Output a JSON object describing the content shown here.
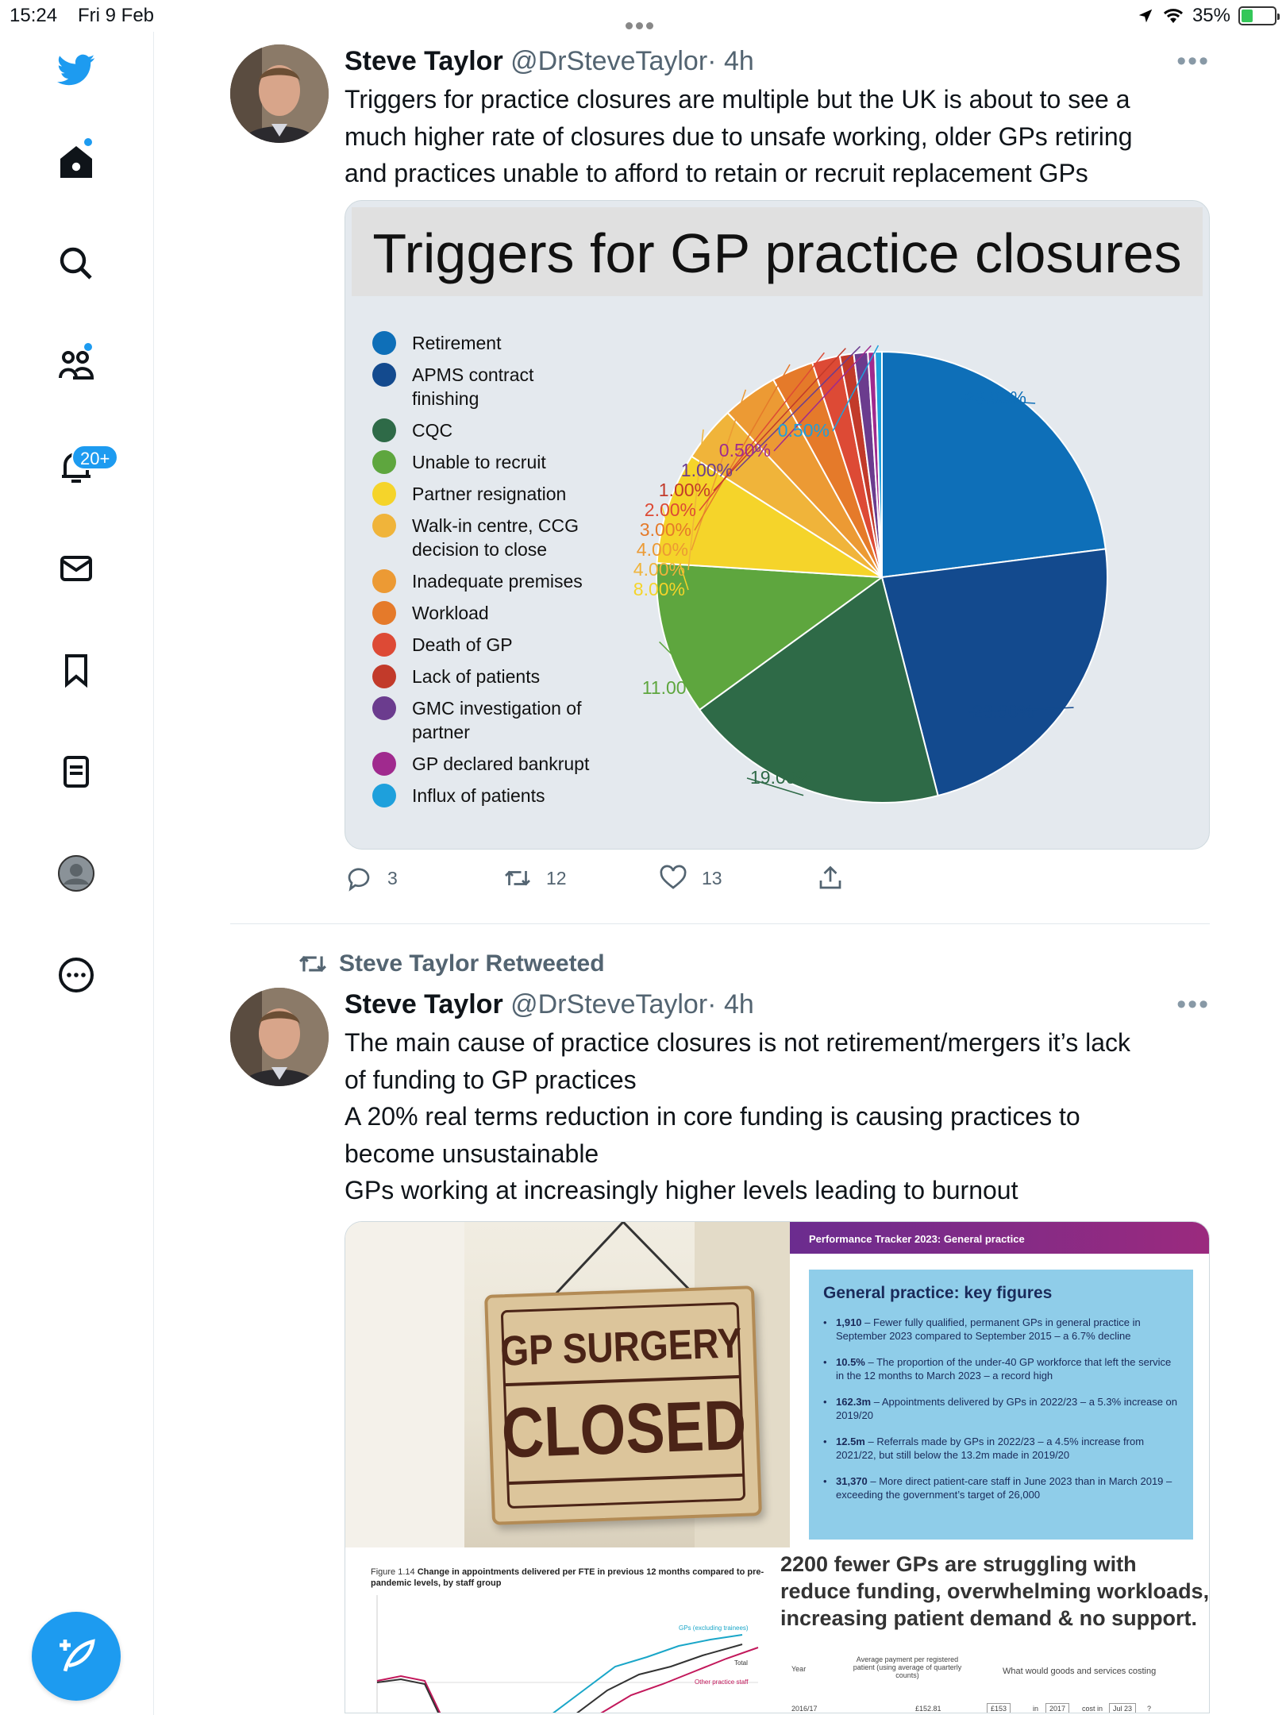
{
  "status_bar": {
    "time": "15:24",
    "date": "Fri 9 Feb",
    "battery": "35%",
    "battery_level": 0.35
  },
  "sidebar": {
    "items": [
      {
        "name": "twitter-logo"
      },
      {
        "name": "home"
      },
      {
        "name": "explore"
      },
      {
        "name": "communities"
      },
      {
        "name": "notifications"
      },
      {
        "name": "messages"
      },
      {
        "name": "bookmarks"
      },
      {
        "name": "lists"
      },
      {
        "name": "profile"
      },
      {
        "name": "more"
      }
    ],
    "notifications_badge": "20+"
  },
  "tweet1": {
    "name": "Steve Taylor",
    "handle": "@DrSteveTaylor",
    "time": "· 4h",
    "text_lines": [
      "Triggers for practice closures are multiple but the UK is about to see a",
      "much higher rate of closures due to unsafe working, older GPs retiring",
      "and practices unable to afford to retain or recruit replacement GPs"
    ],
    "actions": {
      "replies": "3",
      "retweets": "12",
      "likes": "13"
    }
  },
  "chart_data": {
    "type": "pie",
    "title": "Triggers for GP practice closures",
    "labels": [
      "Retirement",
      "APMS contract finishing",
      "CQC",
      "Unable to recruit",
      "Partner resignation",
      "Walk-in centre, CCG decision to close",
      "Inadequate premises",
      "Workload",
      "Death of GP",
      "Lack of patients",
      "GMC investigation of partner",
      "GP declared bankrupt",
      "Influx of patients"
    ],
    "legend_lines": [
      [
        "Retirement"
      ],
      [
        "APMS contract",
        "finishing"
      ],
      [
        "CQC"
      ],
      [
        "Unable to recruit"
      ],
      [
        "Partner resignation"
      ],
      [
        "Walk-in centre, CCG",
        "decision to close"
      ],
      [
        "Inadequate premises"
      ],
      [
        "Workload"
      ],
      [
        "Death of GP"
      ],
      [
        "Lack of patients"
      ],
      [
        "GMC investigation of",
        "partner"
      ],
      [
        "GP declared bankrupt"
      ],
      [
        "Influx of patients"
      ]
    ],
    "values": [
      23,
      23,
      19,
      11,
      8,
      4,
      4,
      3,
      2,
      1,
      1,
      0.5,
      0.5
    ],
    "value_labels": [
      "23.00%",
      "23.00%",
      "19.00%",
      "11.00%",
      "8.00%",
      "4.00%",
      "4.00%",
      "3.00%",
      "2.00%",
      "1.00%",
      "1.00%",
      "0.50%",
      "0.50%"
    ],
    "colors": [
      "#0e6fb8",
      "#134a8e",
      "#2e6a47",
      "#5ea63e",
      "#f5d42a",
      "#f0b43a",
      "#ec9a34",
      "#e57a2a",
      "#dd4a35",
      "#c23a2a",
      "#6b3c8e",
      "#a02a8e",
      "#1ea0dc"
    ],
    "legend": "left"
  },
  "tweet2": {
    "retweeted_by": "Steve Taylor Retweeted",
    "name": "Steve Taylor",
    "handle": "@DrSteveTaylor",
    "time": "· 4h",
    "text_lines": [
      "The main cause of practice closures is not retirement/mergers it’s lack",
      "of funding to GP practices",
      "A 20% real terms reduction in core funding is causing practices to",
      "become unsustainable",
      "GPs working at increasingly higher levels leading to burnout"
    ],
    "media": {
      "sign_line1": "GP SURGERY",
      "sign_line2": "CLOSED",
      "tracker_header": "Performance Tracker 2023: General practice",
      "key_figures_title": "General practice: key figures",
      "key_figures": [
        {
          "bold": "1,910",
          "text": " – Fewer fully qualified, permanent GPs in general practice in September 2023 compared to September 2015 – a 6.7% decline"
        },
        {
          "bold": "10.5%",
          "text": " – The proportion of the under-40 GP workforce that left the service in the 12 months to March 2023 – a record high"
        },
        {
          "bold": "162.3m",
          "text": " – Appointments delivered by GPs in 2022/23 – a 5.3% increase on 2019/20"
        },
        {
          "bold": "12.5m",
          "text": " – Referrals made by GPs in 2022/23 – a 4.5% increase from 2021/22, but still below the 13.2m made in 2019/20"
        },
        {
          "bold": "31,370",
          "text": " – More direct patient-care staff in June 2023 than in March 2019 – exceeding the government’s target of 26,000"
        }
      ],
      "figure_caption_num": "Figure 1.14",
      "figure_caption": "Change in appointments delivered per FTE in previous 12 months compared to pre-pandemic levels, by staff group",
      "figure_series": [
        "GPs (excluding trainees)",
        "Total",
        "Other practice staff"
      ],
      "overlay_text": "2200 fewer GPs are struggling with reduce funding, overwhelming workloads, increasing patient demand & no support.",
      "mini_table": {
        "col_year": "Year",
        "col_payment": "Average payment per registered patient (using average of quarterly counts)",
        "row_year": "2016/17",
        "row_value": "£152.81",
        "calc_title": "What would goods and services costing",
        "calc_amount": "£153",
        "calc_in": "in",
        "calc_year": "2017",
        "calc_cost_in": "cost in",
        "calc_month": "Jul 23",
        "calc_q": "?"
      }
    }
  }
}
